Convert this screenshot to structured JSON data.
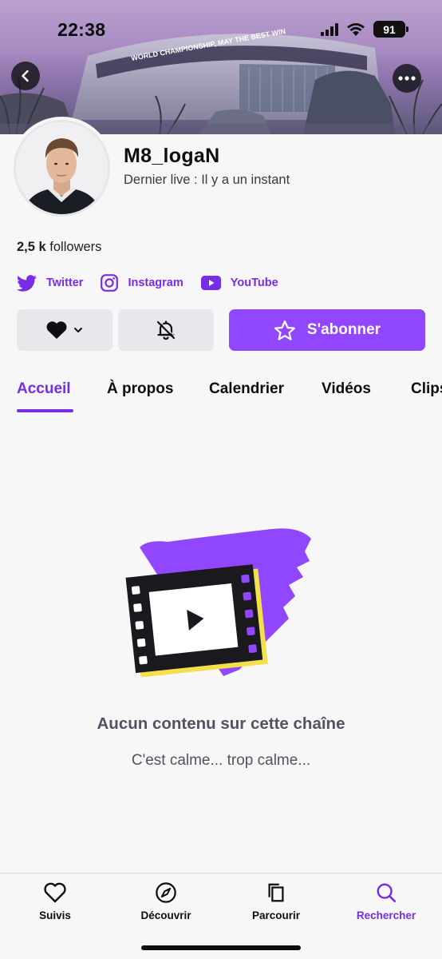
{
  "status_bar": {
    "time": "22:38",
    "battery": "91"
  },
  "banner": {
    "text": "WORLD CHAMPIONSHIP, MAY THE BEST WIN"
  },
  "channel": {
    "name": "M8_logaN",
    "last_live": "Dernier live : Il y a un instant",
    "followers_count": "2,5 k",
    "followers_label": "followers"
  },
  "socials": [
    {
      "label": "Twitter",
      "icon": "twitter-icon"
    },
    {
      "label": "Instagram",
      "icon": "instagram-icon"
    },
    {
      "label": "YouTube",
      "icon": "youtube-icon"
    }
  ],
  "actions": {
    "subscribe_label": "S'abonner"
  },
  "tabs": [
    {
      "label": "Accueil",
      "active": true
    },
    {
      "label": "À propos"
    },
    {
      "label": "Calendrier"
    },
    {
      "label": "Vidéos"
    },
    {
      "label": "Clips"
    }
  ],
  "empty_state": {
    "title": "Aucun contenu sur cette chaîne",
    "subtitle": "C'est calme... trop calme..."
  },
  "bottom_nav": [
    {
      "label": "Suivis",
      "icon": "heart-icon"
    },
    {
      "label": "Découvrir",
      "icon": "compass-icon"
    },
    {
      "label": "Parcourir",
      "icon": "browse-icon"
    },
    {
      "label": "Rechercher",
      "icon": "search-icon",
      "active": true
    }
  ],
  "colors": {
    "accent": "#772ce8",
    "primary_button": "#9147ff",
    "background": "#f7f7f8"
  }
}
